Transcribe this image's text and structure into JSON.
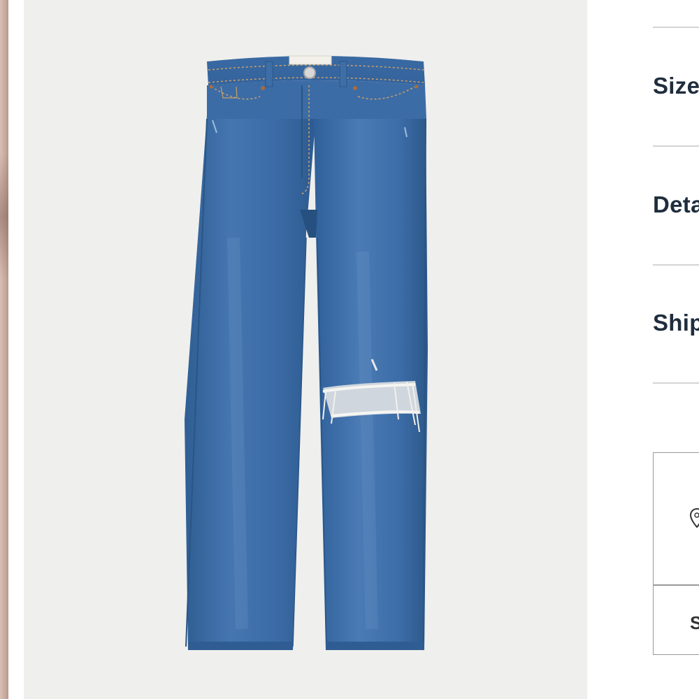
{
  "accordion": {
    "items": [
      {
        "label": "Size"
      },
      {
        "label": "Details"
      },
      {
        "label": "Shipping"
      }
    ]
  },
  "store_pickup": {
    "icon": "location-pin-icon",
    "label": "S"
  },
  "colors": {
    "image_background": "#efefed",
    "denim": "#3d6fa8",
    "heading_text": "#1f2d3d",
    "divider": "#d4d4d4"
  }
}
